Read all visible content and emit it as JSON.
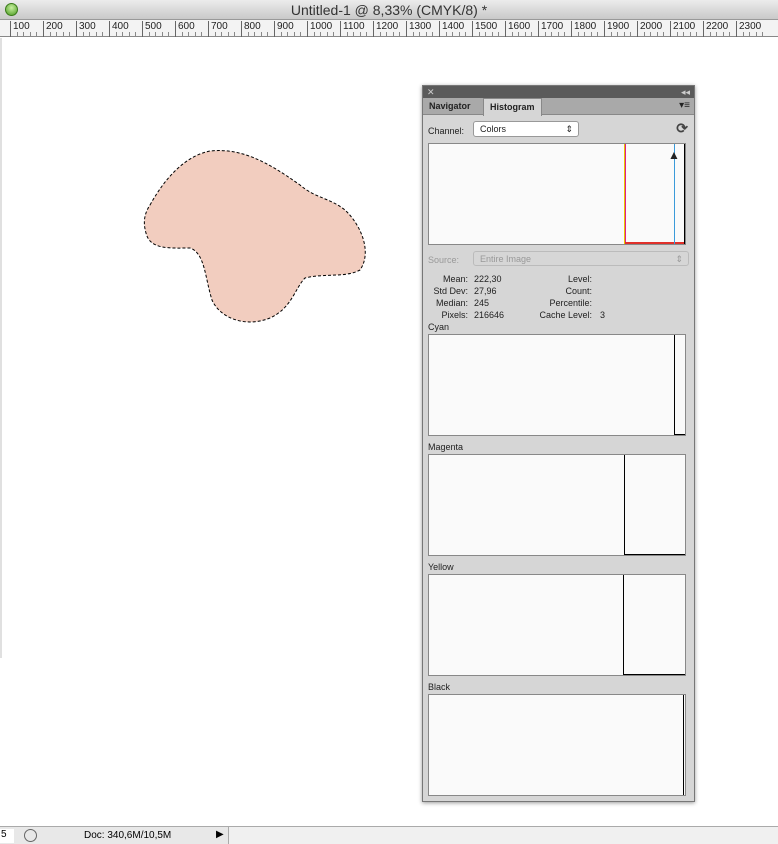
{
  "window": {
    "title": "Untitled-1 @ 8,33% (CMYK/8) *"
  },
  "ruler": {
    "labels": [
      "100",
      "200",
      "300",
      "400",
      "500",
      "600",
      "700",
      "800",
      "900",
      "1000",
      "1100",
      "1200",
      "1300",
      "1400",
      "1500",
      "1600",
      "1700",
      "1800",
      "1900",
      "2000",
      "2100",
      "2200",
      "2300"
    ]
  },
  "selection": {
    "fill_color": "#f2cdbf"
  },
  "status": {
    "zoom": "5",
    "doc": "Doc: 340,6M/10,5M"
  },
  "panel": {
    "tabs": [
      {
        "label": "Navigator",
        "active": false
      },
      {
        "label": "Histogram",
        "active": true
      }
    ],
    "channel_label": "Channel:",
    "channel_value": "Colors",
    "source_label": "Source:",
    "source_value": "Entire Image",
    "stats": {
      "mean_label": "Mean:",
      "mean": "222,30",
      "stddev_label": "Std Dev:",
      "stddev": "27,96",
      "median_label": "Median:",
      "median": "245",
      "pixels_label": "Pixels:",
      "pixels": "216646",
      "level_label": "Level:",
      "count_label": "Count:",
      "percentile_label": "Percentile:",
      "cache_label": "Cache Level:",
      "cache": "3"
    },
    "channels": [
      "Cyan",
      "Magenta",
      "Yellow",
      "Black"
    ]
  }
}
